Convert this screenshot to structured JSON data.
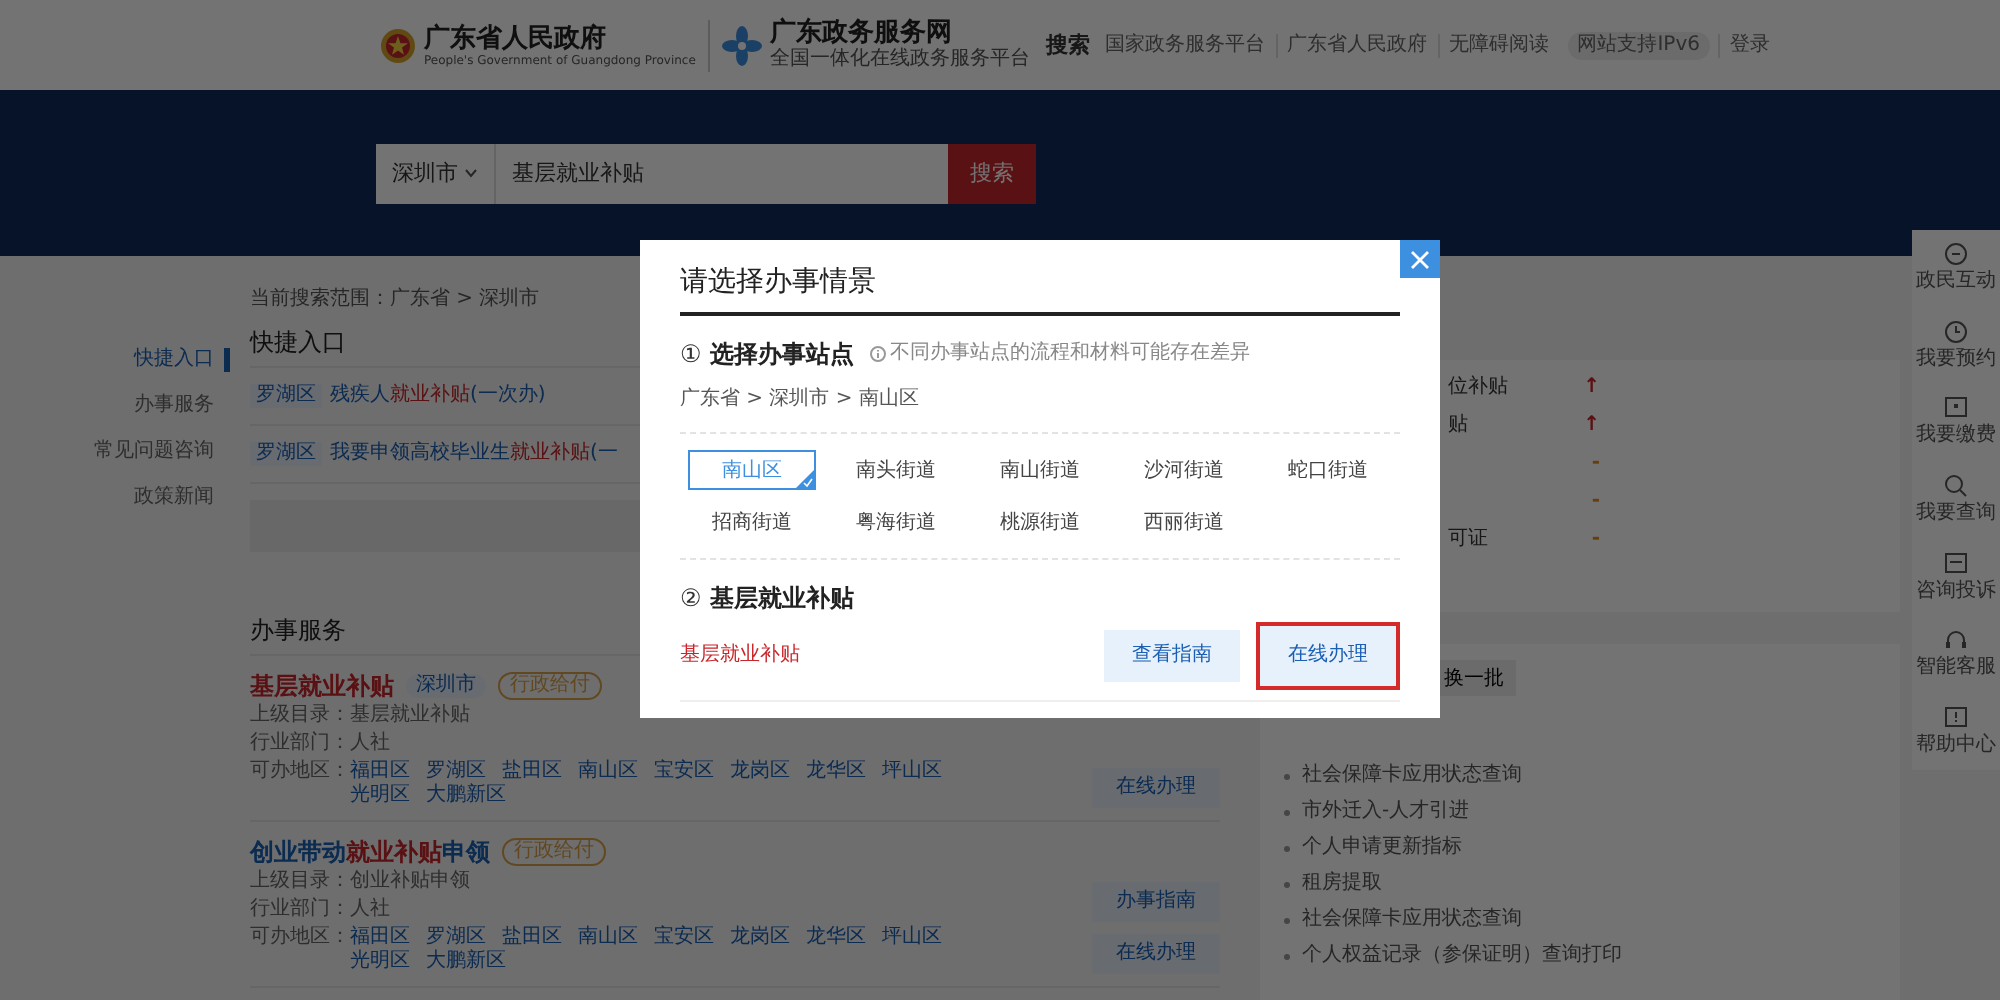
{
  "header": {
    "site_title": "广东省人民政府",
    "site_subtitle": "People's Government of Guangdong Province",
    "portal_title": "广东政务服务网",
    "portal_subtitle": "全国一体化在线政务服务平台",
    "page_label": "搜索",
    "nav_links": [
      {
        "label": "国家政务服务平台",
        "kind": "link"
      },
      {
        "label": "广东省人民政府",
        "kind": "link"
      },
      {
        "label": "无障碍阅读",
        "kind": "link"
      },
      {
        "label": "网站支持IPv6",
        "kind": "badge"
      },
      {
        "label": "登录",
        "kind": "link"
      }
    ]
  },
  "search": {
    "city": "深圳市",
    "value": "基层就业补贴",
    "button": "搜索"
  },
  "side_nav": [
    {
      "label": "快捷入口",
      "selected": true
    },
    {
      "label": "办事服务",
      "selected": false
    },
    {
      "label": "常见问题咨询",
      "selected": false
    },
    {
      "label": "政策新闻",
      "selected": false
    }
  ],
  "scope": "当前搜索范围：广东省 > 深圳市",
  "quick_entry": {
    "title": "快捷入口",
    "items": [
      {
        "region": "罗湖区",
        "text": "残疾人**就业补贴**(一次办)"
      },
      {
        "region": "罗湖区",
        "text": "我要申领高校毕业生**就业补贴**(一"
      }
    ]
  },
  "services": {
    "title": "办事服务",
    "items": [
      {
        "title": "基层就业补贴",
        "title_highlight": true,
        "tags": [
          {
            "label": "深圳市",
            "kind": "region"
          },
          {
            "label": "行政给付",
            "kind": "category"
          }
        ],
        "fields": [
          {
            "label": "上级目录：",
            "value": "基层就业补贴"
          },
          {
            "label": "行业部门：",
            "value": "人社"
          }
        ],
        "areas_label": "可办地区：",
        "areas": [
          "福田区",
          "罗湖区",
          "盐田区",
          "南山区",
          "宝安区",
          "龙岗区",
          "龙华区",
          "坪山区",
          "光明区",
          "大鹏新区"
        ],
        "buttons": [
          "在线办理"
        ]
      },
      {
        "title": "创业带动**就业补贴**申领",
        "title_highlight": false,
        "tags": [
          {
            "label": "行政给付",
            "kind": "category"
          }
        ],
        "fields": [
          {
            "label": "上级目录：",
            "value": "创业补贴申领"
          },
          {
            "label": "行业部门：",
            "value": "人社"
          }
        ],
        "areas_label": "可办地区：",
        "areas": [
          "福田区",
          "罗湖区",
          "盐田区",
          "南山区",
          "宝安区",
          "龙岗区",
          "龙华区",
          "坪山区",
          "光明区",
          "大鹏新区"
        ],
        "buttons": [
          "办事指南",
          "在线办理"
        ]
      }
    ]
  },
  "hot_list": [
    {
      "text": "位补贴",
      "trend": "↑",
      "kind": "up"
    },
    {
      "text": "贴",
      "trend": "↑",
      "kind": "up"
    },
    {
      "trend": "-",
      "kind": "flat"
    },
    {
      "trend": "-",
      "kind": "flat"
    },
    {
      "text": "可证",
      "trend": "-",
      "kind": "flat"
    }
  ],
  "recommend": {
    "refresh_button": "换一批",
    "items": [
      "社会保障卡应用状态查询",
      "市外迁入-人才引进",
      "个人申请更新指标",
      "租房提取",
      "社会保障卡应用状态查询",
      "个人权益记录（参保证明）查询打印"
    ]
  },
  "toolbar": [
    "政民互动",
    "我要预约",
    "我要缴费",
    "我要查询",
    "咨询投诉",
    "智能客服",
    "帮助中心"
  ],
  "dialog": {
    "title": "请选择办事情景",
    "step1": {
      "number": "①",
      "title": "选择办事站点",
      "hint": "不同办事站点的流程和材料可能存在差异"
    },
    "breadcrumb": "广东省 > 深圳市 > 南山区",
    "sites": [
      {
        "label": "南山区",
        "selected": true
      },
      {
        "label": "南头街道",
        "selected": false
      },
      {
        "label": "南山街道",
        "selected": false
      },
      {
        "label": "沙河街道",
        "selected": false
      },
      {
        "label": "蛇口街道",
        "selected": false
      },
      {
        "label": "招商街道",
        "selected": false
      },
      {
        "label": "粤海街道",
        "selected": false
      },
      {
        "label": "桃源街道",
        "selected": false
      },
      {
        "label": "西丽街道",
        "selected": false
      }
    ],
    "step2": {
      "number": "②",
      "title": "基层就业补贴"
    },
    "matter": {
      "name": "基层就业补贴",
      "buttons": [
        {
          "label": "查看指南",
          "highlighted": false
        },
        {
          "label": "在线办理",
          "highlighted": true
        }
      ]
    }
  }
}
